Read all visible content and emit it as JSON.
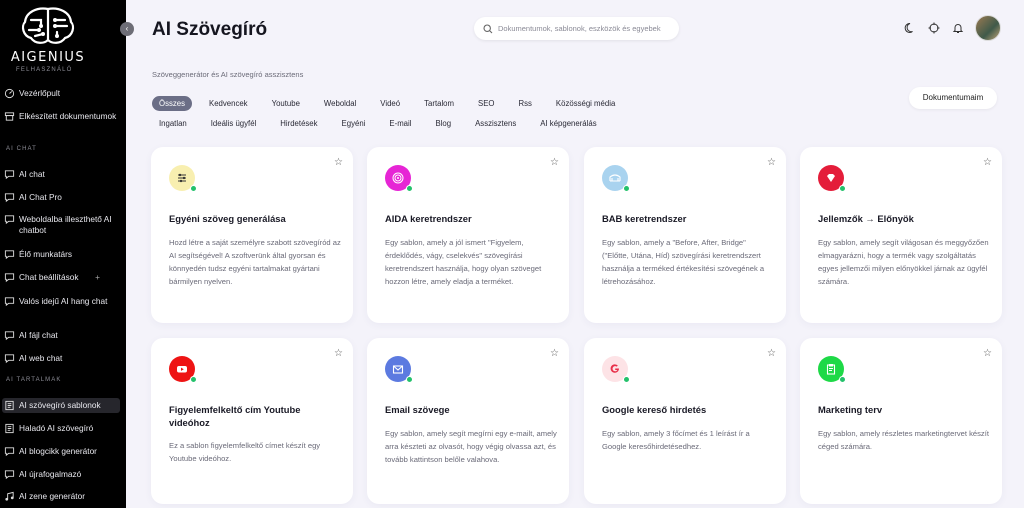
{
  "sidebar": {
    "logo_text": "AIGENIUS",
    "role": "FELHASZNÁLÓ",
    "items_top": [
      {
        "label": "Vezérlőpult"
      },
      {
        "label": "Elkészített dokumentumok"
      }
    ],
    "section_chat": "AI CHAT",
    "items_chat": [
      {
        "label": "AI chat"
      },
      {
        "label": "AI Chat Pro"
      },
      {
        "label": "Weboldalba illeszthető AI chatbot"
      },
      {
        "label": "Élő munkatárs"
      },
      {
        "label": "Chat beállítások"
      },
      {
        "label": "Valós idejű AI hang chat"
      },
      {
        "label": "AI fájl chat"
      },
      {
        "label": "AI web chat"
      }
    ],
    "section_content": "AI TARTALMAK",
    "items_content": [
      {
        "label": "AI szövegíró sablonok"
      },
      {
        "label": "Haladó AI szövegíró"
      },
      {
        "label": "AI blogcikk generátor"
      },
      {
        "label": "AI újrafogalmazó"
      },
      {
        "label": "AI zene generátor"
      }
    ],
    "plus": "+"
  },
  "header": {
    "title": "AI Szövegíró",
    "search_placeholder": "Dokumentumok, sablonok, eszközök és egyebek",
    "subtitle": "Szöveggenerátor és AI szövegíró asszisztens"
  },
  "tabs_row1": [
    "Összes",
    "Kedvencek",
    "Youtube",
    "Weboldal",
    "Videó",
    "Tartalom",
    "SEO",
    "Rss",
    "Közösségi média"
  ],
  "tabs_row2": [
    "Ingatlan",
    "Ideális ügyfél",
    "Hirdetések",
    "Egyéni",
    "E-mail",
    "Blog",
    "Asszisztens",
    "AI képgenerálás"
  ],
  "docs_button": "Dokumentumaim",
  "cards": [
    {
      "title": "Egyéni szöveg generálása",
      "desc": "Hozd létre a saját személyre szabott szövegíród az AI segítségével! A szoftverünk által gyorsan és könnyedén tudsz egyéni tartalmakat gyártani bármilyen nyelven.",
      "icon": "sliders-icon",
      "color": "#f8efb0"
    },
    {
      "title": "AIDA keretrendszer",
      "desc": "Egy sablon, amely a jól ismert \"Figyelem, érdeklődés, vágy, cselekvés\" szövegírási keretrendszert használja, hogy olyan szöveget hozzon létre, amely eladja a terméket.",
      "icon": "target-icon",
      "color": "#e625d5"
    },
    {
      "title": "BAB keretrendszer",
      "desc": "Egy sablon, amely a \"Before, After, Bridge\" (\"Előtte, Utána, Híd) szövegírási keretrendszert használja a terméked értékesítési szövegének a létrehozásához.",
      "icon": "bridge-icon",
      "color": "#a9d3ef"
    },
    {
      "title": "Jellemzők → Előnyök",
      "desc": "Egy sablon, amely segít világosan és meggyőzően elmagyarázni, hogy a termék vagy szolgáltatás egyes jellemzői milyen előnyökkel járnak az ügyfél számára.",
      "icon": "diamond-icon",
      "color": "#e41d3a"
    },
    {
      "title": "Figyelemfelkeltő cím Youtube videóhoz",
      "desc": "Ez a sablon figyelemfelkeltő címet készít egy Youtube videóhoz.",
      "icon": "youtube-icon",
      "color": "#ee1414"
    },
    {
      "title": "Email szövege",
      "desc": "Egy sablon, amely segít megírni egy e-mailt, amely arra készteti az olvasót, hogy végig olvassa azt, és tovább kattintson belőle valahova.",
      "icon": "mail-icon",
      "color": "#5c7ae0"
    },
    {
      "title": "Google kereső hirdetés",
      "desc": "Egy sablon, amely 3 főcímet és 1 leírást ír a Google keresőhirdetésedhez.",
      "icon": "google-icon",
      "color": "#fde3e6"
    },
    {
      "title": "Marketing terv",
      "desc": "Egy sablon, amely részletes marketingtervet készít céged számára.",
      "icon": "clipboard-icon",
      "color": "#1ed947"
    }
  ]
}
